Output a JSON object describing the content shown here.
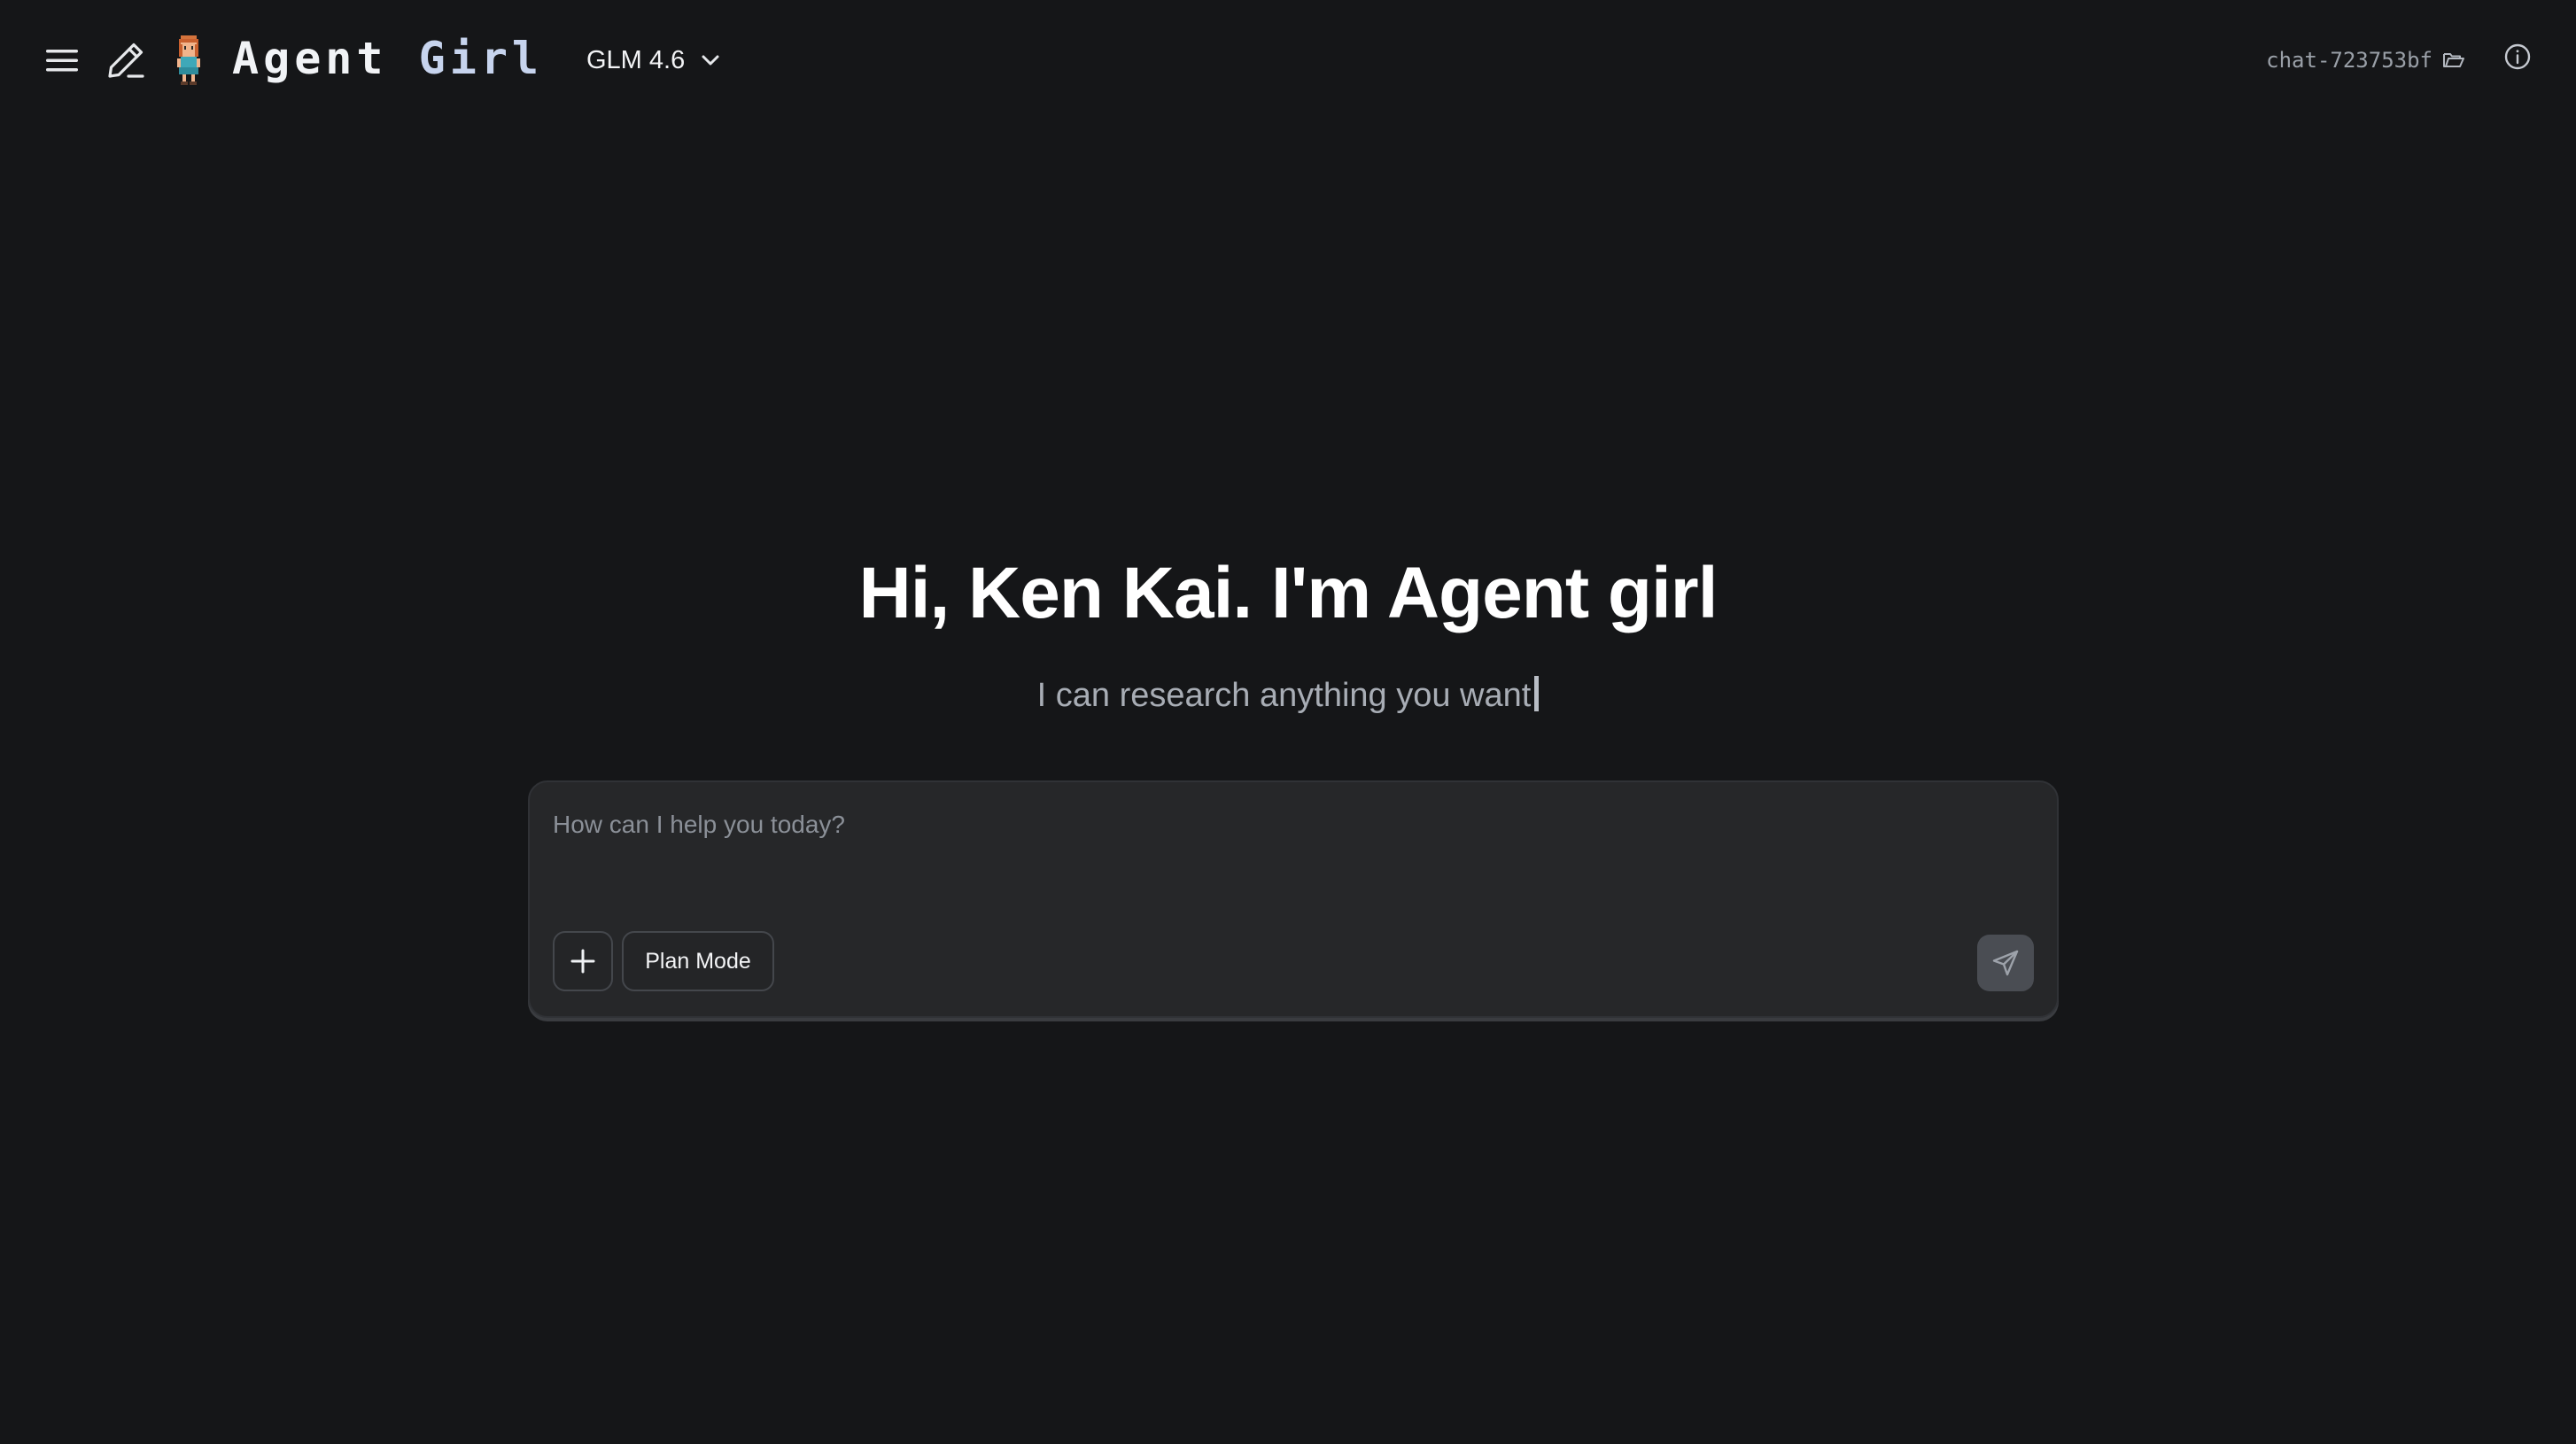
{
  "header": {
    "logo_word1": "Agent",
    "logo_word2": "Girl",
    "model_label": "GLM 4.6",
    "chat_id": "chat-723753bf"
  },
  "hero": {
    "title": "Hi, Ken Kai. I'm Agent girl",
    "subtitle": "I can research anything you want"
  },
  "composer": {
    "placeholder": "How can I help you today?",
    "value": "",
    "plan_mode_label": "Plan Mode"
  },
  "icons": {
    "menu": "hamburger-menu-icon",
    "new_chat": "pencil-icon",
    "avatar": "pixel-girl-avatar",
    "model_dropdown": "chevron-down-icon",
    "folder": "folder-open-icon",
    "info": "info-circle-icon",
    "attach": "plus-icon",
    "send": "send-paper-plane-icon"
  },
  "colors": {
    "background": "#151618",
    "composer_bg": "#262729",
    "send_button_bg": "#4a4d53",
    "title_gradient_end": "#cfdcf3"
  }
}
